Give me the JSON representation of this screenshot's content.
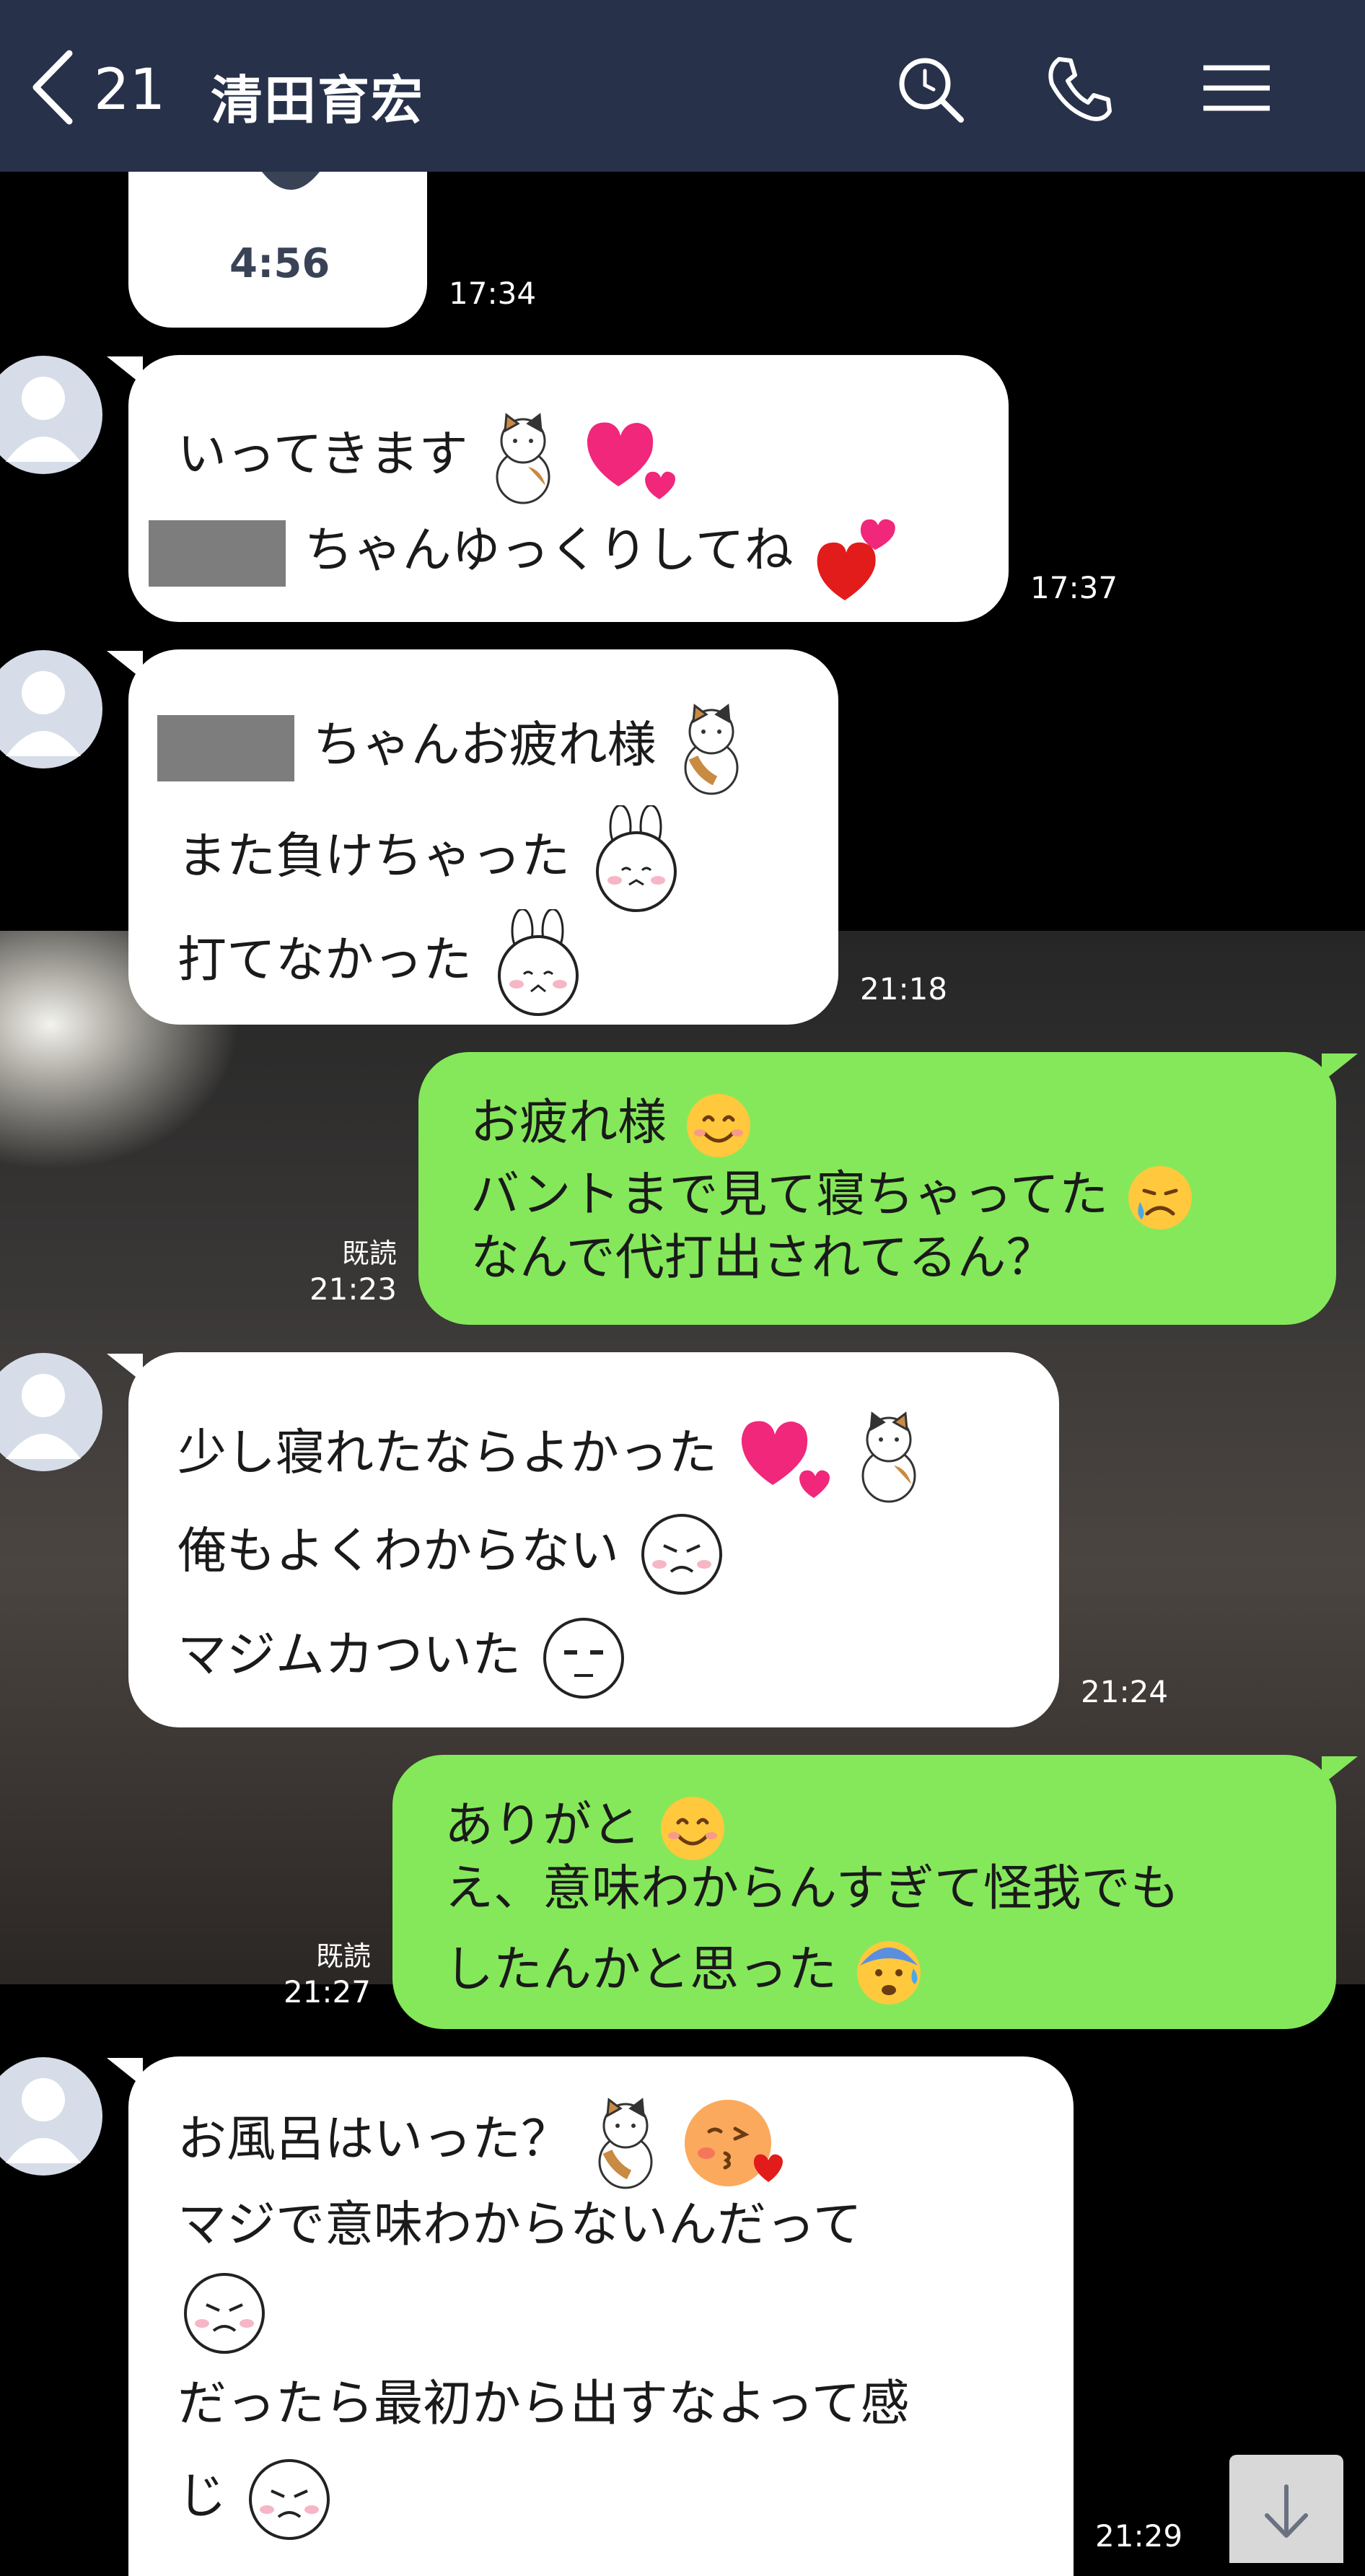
{
  "header": {
    "unread_count": "21",
    "contact_name": "清田育宏",
    "icons": [
      "back-arrow-icon",
      "search-icon",
      "phone-icon",
      "menu-icon"
    ],
    "bg_color": "#27314a"
  },
  "colors": {
    "outgoing_bubble": "#85e85a",
    "incoming_bubble": "#ffffff"
  },
  "messages": {
    "m0": {
      "duration": "4:56",
      "time": "17:34"
    },
    "m1": {
      "line1": "いってきます",
      "line2": "ちゃんゆっくりしてね",
      "time": "17:37"
    },
    "m2": {
      "line1": "ちゃんお疲れ様",
      "line2": "また負けちゃった",
      "line3": "打てなかった",
      "time": "21:18"
    },
    "m3": {
      "line1": "お疲れ様",
      "line2": "バントまで見て寝ちゃってた",
      "line3": "なんで代打出されてるん？",
      "read": "既読",
      "time": "21:23"
    },
    "m4": {
      "line1": "少し寝れたならよかった",
      "line2": "俺もよくわからない",
      "line3": "マジムカついた",
      "time": "21:24"
    },
    "m5": {
      "line1": "ありがと",
      "line2": "え、意味わからんすぎて怪我でも",
      "line3": "したんかと思った",
      "read": "既読",
      "time": "21:27"
    },
    "m6": {
      "line1": "お風呂はいった？",
      "line2": "マジで意味わからないんだって",
      "line4": "だったら最初から出すなよって感",
      "line5": "じ",
      "time": "21:29"
    }
  }
}
